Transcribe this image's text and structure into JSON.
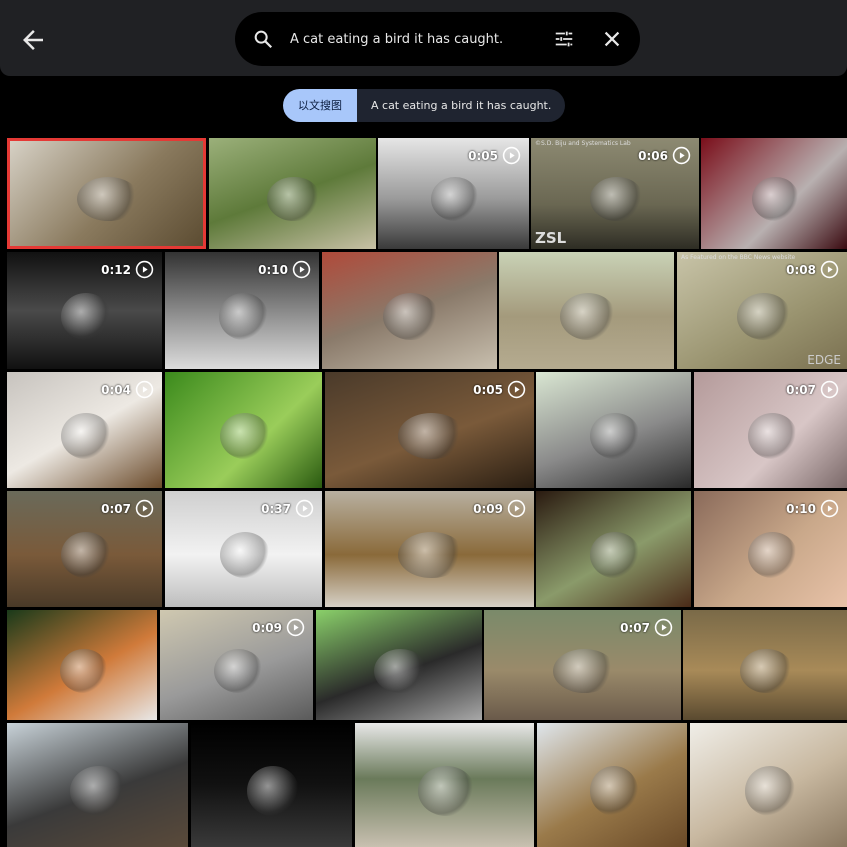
{
  "header": {
    "back_icon": "arrow-left-icon",
    "search_value": "A cat eating a bird it has caught.",
    "search_icon": "search-icon",
    "filter_icon": "tune-icon",
    "clear_icon": "close-icon"
  },
  "chips": {
    "mode_label": "以文搜图",
    "query_label": "A cat eating a bird it has caught."
  },
  "results": [
    {
      "duration": ""
    },
    {
      "duration": ""
    },
    {
      "duration": "0:05"
    },
    {
      "duration": "0:06",
      "tag": "©S.D. Biju and Systematics Lab",
      "watermark": "ZSL"
    },
    {
      "duration": ""
    },
    {
      "duration": "0:12"
    },
    {
      "duration": "0:10"
    },
    {
      "duration": ""
    },
    {
      "duration": ""
    },
    {
      "duration": "0:08",
      "tag": "As Featured on the BBC News website",
      "watermark2": "EDGE"
    },
    {
      "duration": "0:04"
    },
    {
      "duration": ""
    },
    {
      "duration": "0:05"
    },
    {
      "duration": ""
    },
    {
      "duration": "0:07"
    },
    {
      "duration": "0:07"
    },
    {
      "duration": "0:37"
    },
    {
      "duration": "0:09"
    },
    {
      "duration": ""
    },
    {
      "duration": "0:10"
    },
    {
      "duration": ""
    },
    {
      "duration": "0:09"
    },
    {
      "duration": ""
    },
    {
      "duration": "0:07"
    },
    {
      "duration": ""
    },
    {
      "duration": ""
    },
    {
      "duration": ""
    },
    {
      "duration": ""
    },
    {
      "duration": ""
    },
    {
      "duration": ""
    }
  ],
  "colors": {
    "accent_chip": "#a8c7fa",
    "selection": "#e53935",
    "topbar": "#202124"
  }
}
